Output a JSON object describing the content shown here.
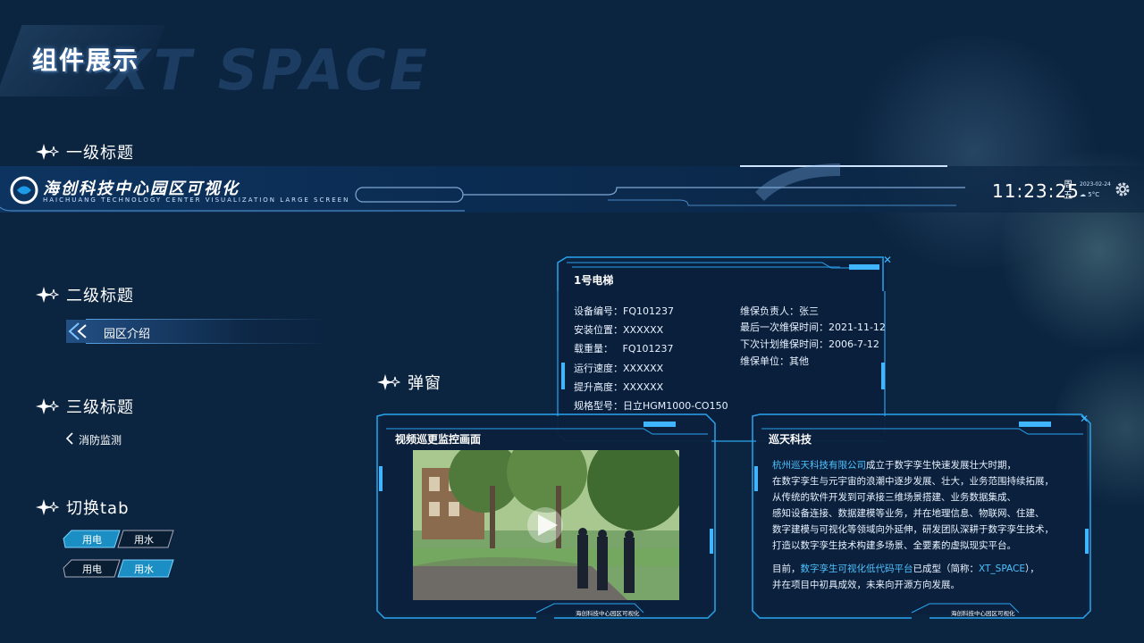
{
  "page": {
    "title": "组件展示",
    "watermark": "XT SPACE"
  },
  "sections": {
    "level1": "一级标题",
    "level2": "二级标题",
    "level3": "三级标题",
    "tabs": "切换tab",
    "popup": "弹窗"
  },
  "header": {
    "title": "海创科技中心园区可视化",
    "subtitle": "HAICHUANG TECHNOLOGY CENTER VISUALIZATION LARGE SCREEN",
    "time": "11:23:25",
    "weekday_1": "周",
    "weekday_2": "五",
    "date": "2023-02-24",
    "temp": "5°C"
  },
  "level2_item": {
    "label": "园区介绍"
  },
  "level3_item": {
    "label": "消防监测"
  },
  "tab_groups": [
    {
      "tabs": [
        "用电",
        "用水"
      ],
      "active": 0
    },
    {
      "tabs": [
        "用电",
        "用水"
      ],
      "active": 1
    }
  ],
  "elevator_panel": {
    "title": "1号电梯",
    "left": [
      {
        "k": "设备编号：",
        "v": "FQ101237"
      },
      {
        "k": "安装位置：",
        "v": "XXXXXX"
      },
      {
        "k": "载重量：",
        "v": "FQ101237"
      },
      {
        "k": "运行速度：",
        "v": "XXXXXX"
      },
      {
        "k": "提升高度：",
        "v": "XXXXXX"
      },
      {
        "k": "规格型号：",
        "v": "日立HGM1000-CO150"
      }
    ],
    "right": [
      {
        "k": "维保负责人：",
        "v": "张三"
      },
      {
        "k": "最后一次维保时间：",
        "v": "2021-11-12"
      },
      {
        "k": "下次计划维保时间：",
        "v": "2006-7-12"
      },
      {
        "k": "维保单位：",
        "v": "其他"
      }
    ]
  },
  "video_panel": {
    "title": "视频巡更监控画面",
    "footer": "海创科技中心园区可视化"
  },
  "company_panel": {
    "title": "巡天科技",
    "company_name": "杭州巡天科技有限公司",
    "p1_rest": "成立于数字孪生快速发展壮大时期，",
    "lines": [
      "在数字孪生与元宇宙的浪潮中逐步发展、壮大，业务范围持续拓展，",
      "从传统的软件开发到可承接三维场景搭建、业务数据集成、",
      "感知设备连接、数据建模等业务，并在地理信息、物联网、住建、",
      "数字建模与可视化等领域向外延伸，研发团队深耕于数字孪生技术，",
      "打造以数字孪生技术构建多场景、全要素的虚拟现实平台。"
    ],
    "p2_prefix": "目前，",
    "p2_platform": "数字孪生可视化低代码平台",
    "p2_mid": "已成型（简称：",
    "p2_short": "XT_SPACE",
    "p2_end": "），",
    "p2_line2": "并在项目中初具成效，未来向开源方向发展。",
    "footer": "海创科技中心园区可视化"
  },
  "colors": {
    "accent": "#1e9be8",
    "bg": "#0b2440",
    "highlight": "#4fc3ff"
  }
}
